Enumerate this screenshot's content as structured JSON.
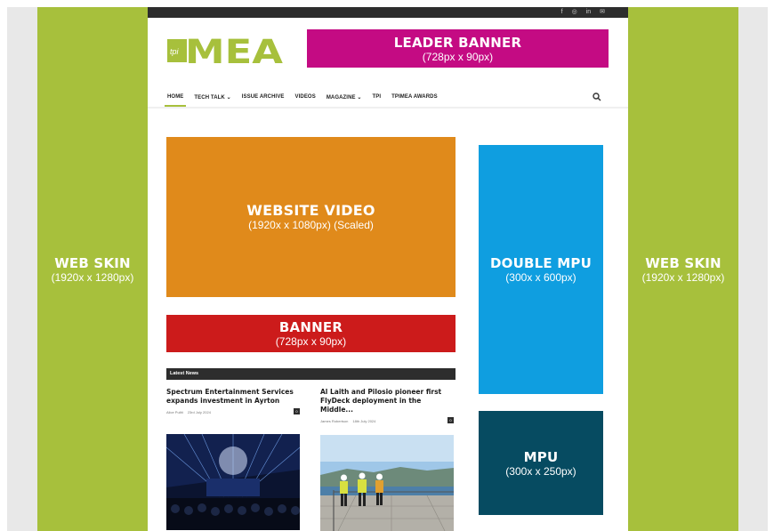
{
  "colors": {
    "skin": "#a7c03c",
    "leader": "#c40b83",
    "video": "#e08a1b",
    "banner": "#cc1b1b",
    "double_mpu": "#0f9ee0",
    "mpu": "#064b61",
    "dark_bar": "#2d2d2d"
  },
  "top_bar": {
    "social_icons": [
      {
        "name": "facebook-icon",
        "glyph": "f"
      },
      {
        "name": "instagram-icon",
        "glyph": "◎"
      },
      {
        "name": "linkedin-icon",
        "glyph": "in"
      },
      {
        "name": "email-icon",
        "glyph": "✉"
      }
    ]
  },
  "logo": {
    "small": "tpi",
    "big": "MEA"
  },
  "ads": {
    "skin_left": {
      "title": "WEB SKIN",
      "size": "(1920x x 1280px)"
    },
    "skin_right": {
      "title": "WEB SKIN",
      "size": "(1920x x 1280px)"
    },
    "leader": {
      "title": "LEADER BANNER",
      "size": "(728px x 90px)"
    },
    "video": {
      "title": "WEBSITE VIDEO",
      "size": "(1920x x 1080px) (Scaled)"
    },
    "banner": {
      "title": "BANNER",
      "size": "(728px x 90px)"
    },
    "double_mpu": {
      "title": "DOUBLE MPU",
      "size": "(300x x 600px)"
    },
    "mpu": {
      "title": "MPU",
      "size": "(300x x 250px)"
    }
  },
  "nav": {
    "items": [
      {
        "label": "HOME"
      },
      {
        "label": "TECH TALK ⌄"
      },
      {
        "label": "ISSUE ARCHIVE"
      },
      {
        "label": "VIDEOS"
      },
      {
        "label": "MAGAZINE ⌄"
      },
      {
        "label": "TPI"
      },
      {
        "label": "TPIMEA AWARDS"
      }
    ],
    "search_icon": "search-icon"
  },
  "news": {
    "header": "Latest News",
    "articles": [
      {
        "title": "Spectrum Entertainment Services expands investment in Ayrton",
        "author": "Alice Pulitt",
        "date": "23rd July 2024",
        "comments": "0"
      },
      {
        "title": "Al Laith and Pilosio pioneer first FlyDeck deployment in the Middle...",
        "author": "James Robertson",
        "date": "18th July 2024",
        "comments": "0"
      }
    ]
  }
}
